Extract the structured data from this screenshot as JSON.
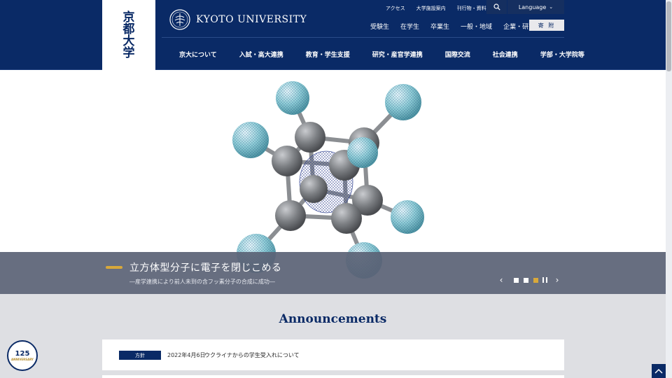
{
  "logo": {
    "vertical_chars": [
      "京",
      "都",
      "大",
      "学"
    ],
    "name": "KYOTO UNIVERSITY"
  },
  "utility_links": [
    "アクセス",
    "大学施設案内",
    "刊行物・資料請求"
  ],
  "language": {
    "label": "Language"
  },
  "audience_links": [
    "受験生",
    "在学生",
    "卒業生",
    "一般・地域",
    "企業・研究者"
  ],
  "donate_label": "寄 附",
  "main_nav": [
    "京大について",
    "入試・高大連携",
    "教育・学生支援",
    "研究・産官学連携",
    "国際交流",
    "社会連携",
    "学部・大学院等"
  ],
  "hero": {
    "title": "立方体型分子に電子を閉じこめる",
    "subtitle": "―産学連携により前人未到の含フッ素分子の合成に成功―",
    "slides": 3,
    "active_slide": 3
  },
  "announcements": {
    "heading": "Announcements",
    "items": [
      {
        "tag": "方針",
        "date": "2022年4月6日",
        "text": "ウクライナからの学生受入れについて"
      }
    ]
  },
  "colors": {
    "navy": "#0a2a66",
    "accent": "#d8a83a"
  },
  "icons": [
    "search-icon",
    "chevron-down-icon",
    "chevron-left-icon",
    "chevron-right-icon",
    "pause-icon",
    "arrow-up-icon"
  ]
}
